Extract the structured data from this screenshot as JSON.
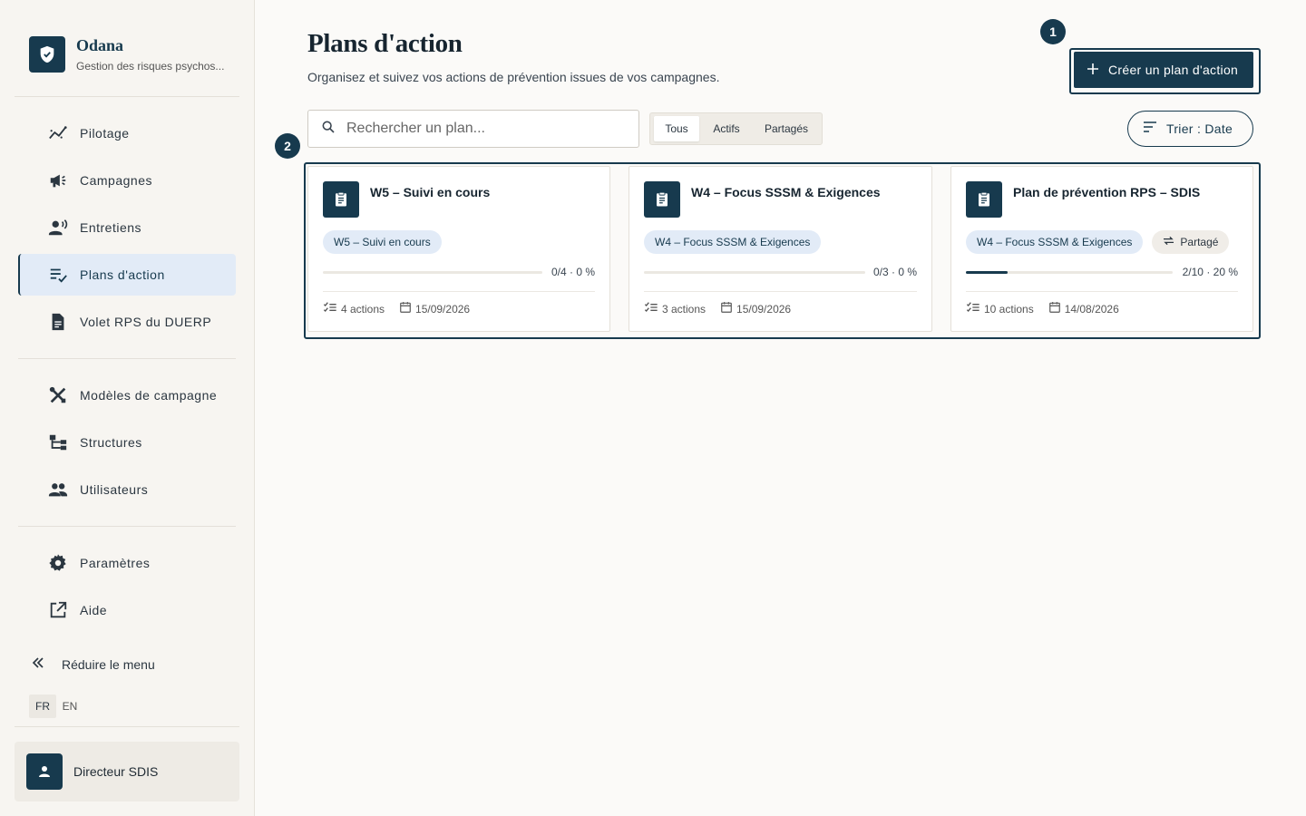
{
  "brand": {
    "name": "Odana",
    "subtitle": "Gestion des risques psychos..."
  },
  "sidebar": {
    "items": [
      {
        "label": "Pilotage",
        "icon": "chart-line-icon"
      },
      {
        "label": "Campagnes",
        "icon": "megaphone-icon"
      },
      {
        "label": "Entretiens",
        "icon": "person-voice-icon"
      },
      {
        "label": "Plans d'action",
        "icon": "checklist-icon",
        "active": true
      },
      {
        "label": "Volet RPS du DUERP",
        "icon": "document-icon"
      },
      {
        "label": "Modèles de campagne",
        "icon": "tools-icon"
      },
      {
        "label": "Structures",
        "icon": "hierarchy-icon"
      },
      {
        "label": "Utilisateurs",
        "icon": "users-icon"
      },
      {
        "label": "Paramètres",
        "icon": "gear-icon"
      },
      {
        "label": "Aide",
        "icon": "external-link-icon"
      }
    ],
    "collapse_label": "Réduire le menu",
    "languages": [
      "FR",
      "EN"
    ],
    "active_language": "FR",
    "user": "Directeur SDIS"
  },
  "main": {
    "title": "Plans d'action",
    "subtitle": "Organisez et suivez vos actions de prévention issues de vos campagnes.",
    "create_label": "Créer un plan d'action",
    "search_placeholder": "Rechercher un plan...",
    "filters": [
      "Tous",
      "Actifs",
      "Partagés"
    ],
    "active_filter": "Tous",
    "sort_label": "Trier : Date",
    "annotations": [
      "1",
      "2"
    ]
  },
  "cards": [
    {
      "title": "W5 – Suivi en cours",
      "campaign": "W5 – Suivi en cours",
      "shared": "",
      "progress_fraction": 0.0,
      "progress_text": "0/4 · 0 %",
      "actions": "4 actions",
      "date": "15/09/2026"
    },
    {
      "title": "W4 – Focus SSSM & Exigences",
      "campaign": "W4 – Focus SSSM & Exigences",
      "shared": "",
      "progress_fraction": 0.0,
      "progress_text": "0/3 · 0 %",
      "actions": "3 actions",
      "date": "15/09/2026"
    },
    {
      "title": "Plan de prévention RPS – SDIS",
      "campaign": "W4 – Focus SSSM & Exigences",
      "shared": "Partagé",
      "progress_fraction": 0.2,
      "progress_text": "2/10 · 20 %",
      "actions": "10 actions",
      "date": "14/08/2026"
    }
  ],
  "colors": {
    "primary": "#173a4e",
    "chip_bg": "#e2ebf7",
    "page_bg": "#fbfaf8"
  }
}
